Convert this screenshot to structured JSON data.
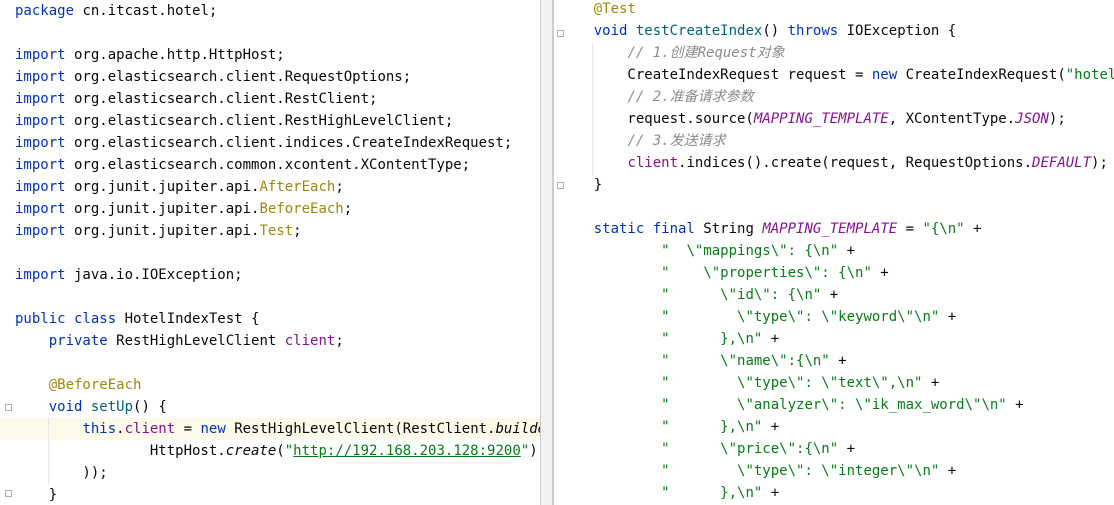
{
  "editor_left": {
    "lines": [
      [
        {
          "t": "package",
          "c": "kw"
        },
        {
          "t": " cn.itcast.hotel;",
          "c": ""
        }
      ],
      [],
      [
        {
          "t": "import",
          "c": "kw"
        },
        {
          "t": " org.apache.http.HttpHost;",
          "c": ""
        }
      ],
      [
        {
          "t": "import",
          "c": "kw"
        },
        {
          "t": " org.elasticsearch.client.RequestOptions;",
          "c": ""
        }
      ],
      [
        {
          "t": "import",
          "c": "kw"
        },
        {
          "t": " org.elasticsearch.client.RestClient;",
          "c": ""
        }
      ],
      [
        {
          "t": "import",
          "c": "kw"
        },
        {
          "t": " org.elasticsearch.client.RestHighLevelClient;",
          "c": ""
        }
      ],
      [
        {
          "t": "import",
          "c": "kw"
        },
        {
          "t": " org.elasticsearch.client.indices.CreateIndexRequest;",
          "c": ""
        }
      ],
      [
        {
          "t": "import",
          "c": "kw"
        },
        {
          "t": " org.elasticsearch.common.xcontent.XContentType;",
          "c": ""
        }
      ],
      [
        {
          "t": "import",
          "c": "kw"
        },
        {
          "t": " org.junit.jupiter.api.",
          "c": ""
        },
        {
          "t": "AfterEach",
          "c": "cls"
        },
        {
          "t": ";",
          "c": ""
        }
      ],
      [
        {
          "t": "import",
          "c": "kw"
        },
        {
          "t": " org.junit.jupiter.api.",
          "c": ""
        },
        {
          "t": "BeforeEach",
          "c": "cls"
        },
        {
          "t": ";",
          "c": ""
        }
      ],
      [
        {
          "t": "import",
          "c": "kw"
        },
        {
          "t": " org.junit.jupiter.api.",
          "c": ""
        },
        {
          "t": "Test",
          "c": "cls"
        },
        {
          "t": ";",
          "c": ""
        }
      ],
      [],
      [
        {
          "t": "import",
          "c": "kw"
        },
        {
          "t": " java.io.IOException;",
          "c": ""
        }
      ],
      [],
      [
        {
          "t": "public class",
          "c": "kw"
        },
        {
          "t": " HotelIndexTest {",
          "c": ""
        }
      ],
      [
        {
          "t": "    ",
          "c": ""
        },
        {
          "t": "private",
          "c": "kw"
        },
        {
          "t": " RestHighLevelClient ",
          "c": ""
        },
        {
          "t": "client",
          "c": "fld"
        },
        {
          "t": ";",
          "c": ""
        }
      ],
      [],
      [
        {
          "t": "    ",
          "c": ""
        },
        {
          "t": "@BeforeEach",
          "c": "ann"
        }
      ],
      [
        {
          "t": "    ",
          "c": ""
        },
        {
          "t": "void",
          "c": "kw"
        },
        {
          "t": " ",
          "c": ""
        },
        {
          "t": "setUp",
          "c": "fn"
        },
        {
          "t": "() {",
          "c": ""
        }
      ],
      [
        {
          "t": "        ",
          "c": ""
        },
        {
          "t": "this",
          "c": "kw"
        },
        {
          "t": ".",
          "c": ""
        },
        {
          "t": "client",
          "c": "fld"
        },
        {
          "t": " = ",
          "c": ""
        },
        {
          "t": "new",
          "c": "kw"
        },
        {
          "t": " RestHighLevelClient(RestClient.",
          "c": ""
        },
        {
          "t": "builder",
          "c": "ital"
        },
        {
          "t": "(",
          "c": ""
        }
      ],
      [
        {
          "t": "                ",
          "c": ""
        },
        {
          "t": "HttpHost.",
          "c": ""
        },
        {
          "t": "create",
          "c": "ital"
        },
        {
          "t": "(",
          "c": ""
        },
        {
          "t": "\"",
          "c": "str"
        },
        {
          "t": "http://192.168.203.128:9200",
          "c": "url"
        },
        {
          "t": "\"",
          "c": "str"
        },
        {
          "t": ")",
          "c": ""
        }
      ],
      [
        {
          "t": "        ));",
          "c": ""
        }
      ],
      [
        {
          "t": "    }",
          "c": ""
        }
      ]
    ]
  },
  "editor_right": {
    "lines": [
      [
        {
          "t": "    ",
          "c": ""
        },
        {
          "t": "@Test",
          "c": "ann"
        }
      ],
      [
        {
          "t": "    ",
          "c": ""
        },
        {
          "t": "void",
          "c": "kw"
        },
        {
          "t": " ",
          "c": ""
        },
        {
          "t": "testCreateIndex",
          "c": "fn"
        },
        {
          "t": "() ",
          "c": ""
        },
        {
          "t": "throws",
          "c": "kw"
        },
        {
          "t": " IOException {",
          "c": ""
        }
      ],
      [
        {
          "t": "        ",
          "c": ""
        },
        {
          "t": "// 1.创建Request对象",
          "c": "com"
        }
      ],
      [
        {
          "t": "        CreateIndexRequest request = ",
          "c": ""
        },
        {
          "t": "new",
          "c": "kw"
        },
        {
          "t": " CreateIndexRequest(",
          "c": ""
        },
        {
          "t": "\"hotel\"",
          "c": "str"
        },
        {
          "t": ");",
          "c": ""
        }
      ],
      [
        {
          "t": "        ",
          "c": ""
        },
        {
          "t": "// 2.准备请求参数",
          "c": "com"
        }
      ],
      [
        {
          "t": "        request.source(",
          "c": ""
        },
        {
          "t": "MAPPING_TEMPLATE",
          "c": "const"
        },
        {
          "t": ", XContentType.",
          "c": ""
        },
        {
          "t": "JSON",
          "c": "const"
        },
        {
          "t": ");",
          "c": ""
        }
      ],
      [
        {
          "t": "        ",
          "c": ""
        },
        {
          "t": "// 3.发送请求",
          "c": "com"
        }
      ],
      [
        {
          "t": "        ",
          "c": ""
        },
        {
          "t": "client",
          "c": "fld"
        },
        {
          "t": ".indices().create(request, RequestOptions.",
          "c": ""
        },
        {
          "t": "DEFAULT",
          "c": "const"
        },
        {
          "t": ");",
          "c": ""
        }
      ],
      [
        {
          "t": "    }",
          "c": ""
        }
      ],
      [],
      [
        {
          "t": "    ",
          "c": ""
        },
        {
          "t": "static final",
          "c": "kw"
        },
        {
          "t": " String ",
          "c": ""
        },
        {
          "t": "MAPPING_TEMPLATE",
          "c": "const"
        },
        {
          "t": " = ",
          "c": ""
        },
        {
          "t": "\"{\\n\"",
          "c": "str"
        },
        {
          "t": " +",
          "c": ""
        }
      ],
      [
        {
          "t": "            ",
          "c": ""
        },
        {
          "t": "\"  \\\"mappings\\\": {\\n\"",
          "c": "str"
        },
        {
          "t": " +",
          "c": ""
        }
      ],
      [
        {
          "t": "            ",
          "c": ""
        },
        {
          "t": "\"    \\\"properties\\\": {\\n\"",
          "c": "str"
        },
        {
          "t": " +",
          "c": ""
        }
      ],
      [
        {
          "t": "            ",
          "c": ""
        },
        {
          "t": "\"      \\\"id\\\": {\\n\"",
          "c": "str"
        },
        {
          "t": " +",
          "c": ""
        }
      ],
      [
        {
          "t": "            ",
          "c": ""
        },
        {
          "t": "\"        \\\"type\\\": \\\"keyword\\\"\\n\"",
          "c": "str"
        },
        {
          "t": " +",
          "c": ""
        }
      ],
      [
        {
          "t": "            ",
          "c": ""
        },
        {
          "t": "\"      },\\n\"",
          "c": "str"
        },
        {
          "t": " +",
          "c": ""
        }
      ],
      [
        {
          "t": "            ",
          "c": ""
        },
        {
          "t": "\"      \\\"name\\\":{\\n\"",
          "c": "str"
        },
        {
          "t": " +",
          "c": ""
        }
      ],
      [
        {
          "t": "            ",
          "c": ""
        },
        {
          "t": "\"        \\\"type\\\": \\\"text\\\",\\n\"",
          "c": "str"
        },
        {
          "t": " +",
          "c": ""
        }
      ],
      [
        {
          "t": "            ",
          "c": ""
        },
        {
          "t": "\"        \\\"analyzer\\\": \\\"ik_max_word\\\"\\n\"",
          "c": "str"
        },
        {
          "t": " +",
          "c": ""
        }
      ],
      [
        {
          "t": "            ",
          "c": ""
        },
        {
          "t": "\"      },\\n\"",
          "c": "str"
        },
        {
          "t": " +",
          "c": ""
        }
      ],
      [
        {
          "t": "            ",
          "c": ""
        },
        {
          "t": "\"      \\\"price\\\":{\\n\"",
          "c": "str"
        },
        {
          "t": " +",
          "c": ""
        }
      ],
      [
        {
          "t": "            ",
          "c": ""
        },
        {
          "t": "\"        \\\"type\\\": \\\"integer\\\"\\n\"",
          "c": "str"
        },
        {
          "t": " +",
          "c": ""
        }
      ],
      [
        {
          "t": "            ",
          "c": ""
        },
        {
          "t": "\"      },\\n\"",
          "c": "str"
        },
        {
          "t": " +",
          "c": ""
        }
      ]
    ]
  }
}
